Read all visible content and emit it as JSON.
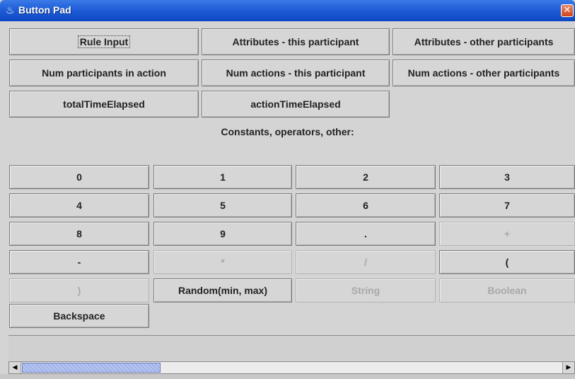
{
  "window": {
    "title": "Button Pad",
    "close_glyph": "✕",
    "icon": "java-cup-icon"
  },
  "top_rows": [
    [
      "Rule Input",
      "Attributes - this participant",
      "Attributes - other participants"
    ],
    [
      "Num participants in action",
      "Num actions - this participant",
      "Num actions - other participants"
    ],
    [
      "totalTimeElapsed",
      "actionTimeElapsed"
    ]
  ],
  "section_label": "Constants, operators, other:",
  "grid": [
    [
      "0",
      "1",
      "2",
      "3"
    ],
    [
      "4",
      "5",
      "6",
      "7"
    ],
    [
      "8",
      "9",
      ".",
      "+"
    ],
    [
      "-",
      "*",
      "/",
      "("
    ],
    [
      ")",
      "Random(min, max)",
      "String",
      "Boolean"
    ]
  ],
  "disabled": [
    "+",
    "*",
    "/",
    ")",
    "String",
    "Boolean"
  ],
  "backspace": "Backspace",
  "scrollbar": {
    "left_arrow": "◀",
    "right_arrow": "▶"
  }
}
